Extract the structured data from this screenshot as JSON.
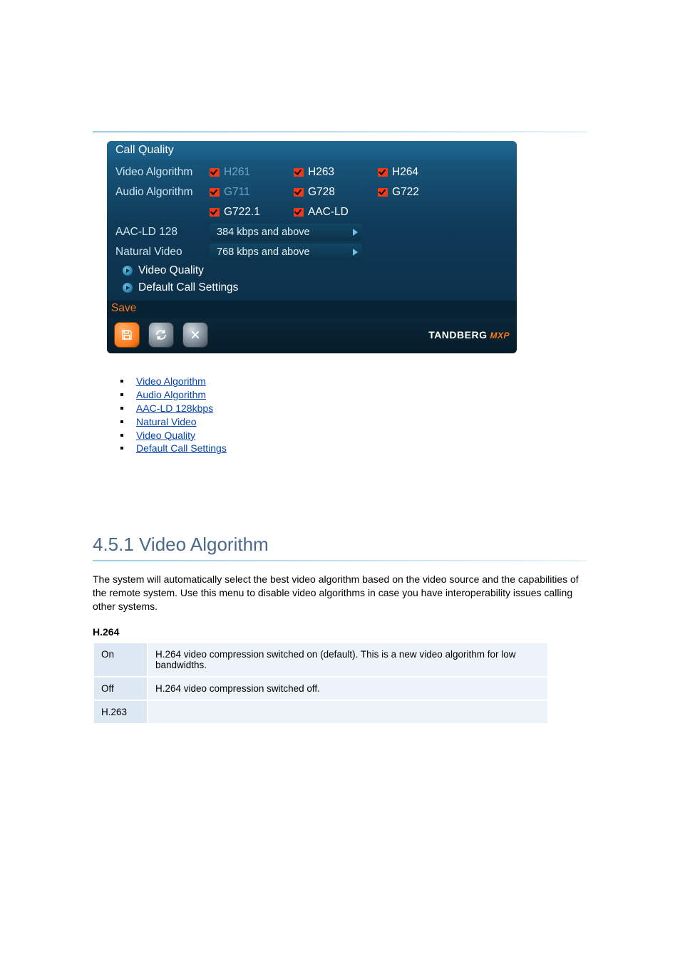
{
  "panel": {
    "title": "Call Quality",
    "rows": {
      "video_algorithm": {
        "label": "Video Algorithm",
        "opts": [
          "H261",
          "H263",
          "H264"
        ]
      },
      "audio_algorithm": {
        "label": "Audio Algorithm",
        "opts": [
          "G711",
          "G728",
          "G722"
        ]
      },
      "audio_algorithm2": {
        "opts": [
          "G722.1",
          "AAC-LD"
        ]
      },
      "aac_ld": {
        "label": "AAC-LD 128",
        "dropdown": "384 kbps and above"
      },
      "natural_video": {
        "label": "Natural Video",
        "dropdown": "768 kbps and above"
      }
    },
    "links": {
      "video_quality": "Video Quality",
      "default_call": "Default Call Settings"
    },
    "save": "Save",
    "brand": {
      "name": "TANDBERG",
      "suffix": "MXP"
    }
  },
  "bullets": [
    "Video Algorithm",
    "Audio Algorithm",
    "AAC-LD 128kbps",
    "Natural Video",
    "Video Quality",
    "Default Call Settings"
  ],
  "section": {
    "heading": "4.5.1 Video Algorithm",
    "body": "The system will automatically select the best video algorithm based on the video source and the capabilities of the remote system. Use this menu to disable video algorithms in case you have interoperability issues calling other systems.",
    "subheading": "H.264",
    "table": {
      "rows": [
        {
          "c1": "On",
          "c2": "H.264 video compression switched on (default). This is a new video algorithm for low bandwidths."
        },
        {
          "c1": "Off",
          "c2": "H.264 video compression switched off."
        },
        {
          "c1": "H.263",
          "c2": ""
        }
      ]
    }
  }
}
